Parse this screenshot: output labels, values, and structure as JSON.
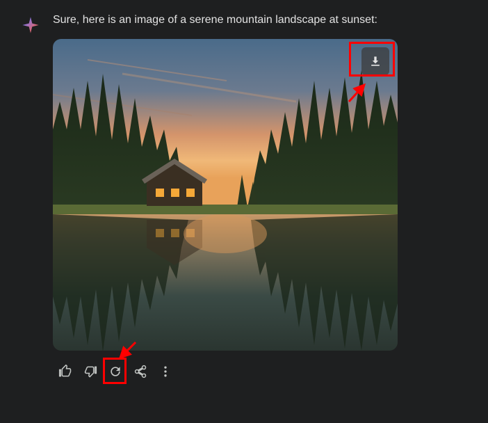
{
  "response": {
    "text": "Sure, here is an image of a serene mountain landscape at sunset:"
  },
  "image": {
    "alt": "serene mountain landscape at sunset with cabin and lake reflection"
  },
  "icons": {
    "sparkle": "sparkle-icon",
    "download": "download-icon",
    "thumbs_up": "thumbs-up-icon",
    "thumbs_down": "thumbs-down-icon",
    "regenerate": "regenerate-icon",
    "share": "share-icon",
    "more": "more-options-icon"
  },
  "annotations": {
    "download_highlight": true,
    "regenerate_highlight": true
  }
}
